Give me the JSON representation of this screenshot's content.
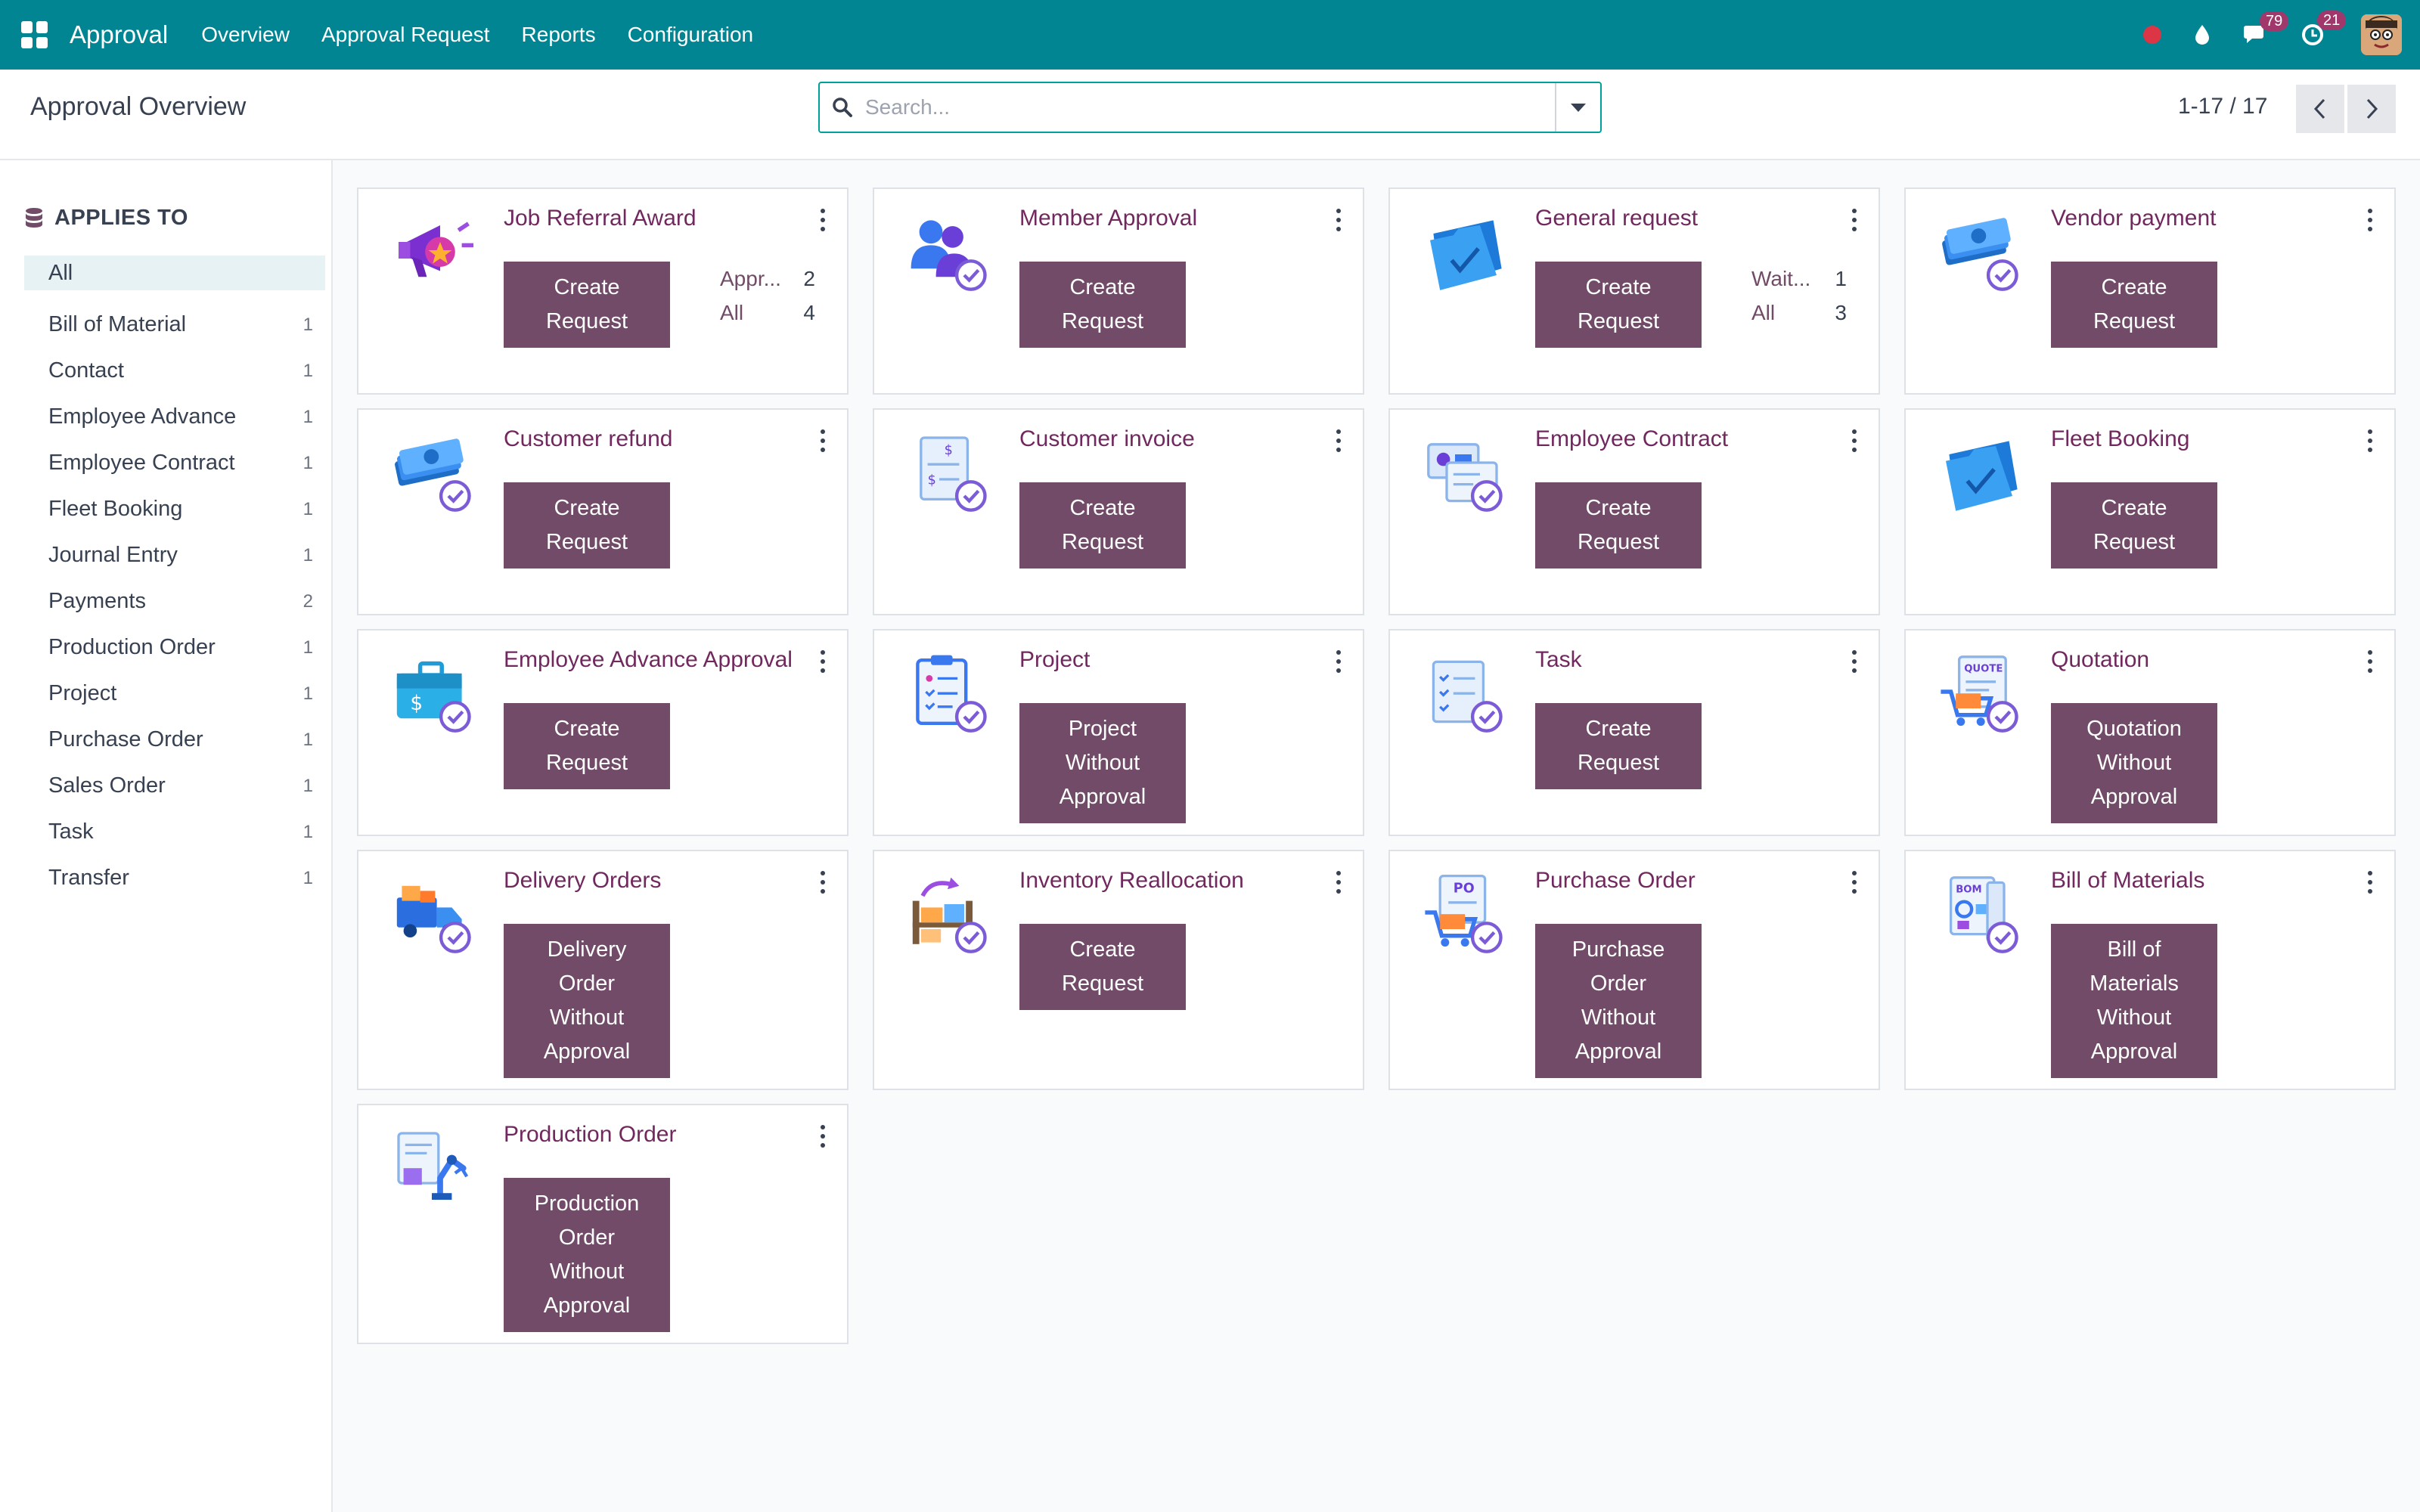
{
  "nav": {
    "app_name": "Approval",
    "menu": [
      "Overview",
      "Approval Request",
      "Reports",
      "Configuration"
    ],
    "messages_count": "79",
    "activities_count": "21"
  },
  "control_panel": {
    "title": "Approval Overview",
    "search_placeholder": "Search...",
    "pager": "1-17 / 17"
  },
  "sidebar": {
    "header": "APPLIES TO",
    "items": [
      {
        "label": "All",
        "count": ""
      },
      {
        "label": "Bill of Material",
        "count": "1"
      },
      {
        "label": "Contact",
        "count": "1"
      },
      {
        "label": "Employee Advance",
        "count": "1"
      },
      {
        "label": "Employee Contract",
        "count": "1"
      },
      {
        "label": "Fleet Booking",
        "count": "1"
      },
      {
        "label": "Journal Entry",
        "count": "1"
      },
      {
        "label": "Payments",
        "count": "2"
      },
      {
        "label": "Production Order",
        "count": "1"
      },
      {
        "label": "Project",
        "count": "1"
      },
      {
        "label": "Purchase Order",
        "count": "1"
      },
      {
        "label": "Sales Order",
        "count": "1"
      },
      {
        "label": "Task",
        "count": "1"
      },
      {
        "label": "Transfer",
        "count": "1"
      }
    ]
  },
  "cards": [
    {
      "title": "Job Referral Award",
      "icon": "megaphone-award-icon",
      "button": "Create\nRequest",
      "stats": [
        {
          "label": "Appr...",
          "value": "2"
        },
        {
          "label": "All",
          "value": "4"
        }
      ]
    },
    {
      "title": "Member Approval",
      "icon": "users-check-icon",
      "button": "Create\nRequest"
    },
    {
      "title": "General request",
      "icon": "folder-check-icon",
      "button": "Create\nRequest",
      "stats": [
        {
          "label": "Wait...",
          "value": "1"
        },
        {
          "label": "All",
          "value": "3"
        }
      ]
    },
    {
      "title": "Vendor payment",
      "icon": "money-check-icon",
      "button": "Create\nRequest"
    },
    {
      "title": "Customer refund",
      "icon": "money-check-icon",
      "button": "Create\nRequest"
    },
    {
      "title": "Customer invoice",
      "icon": "invoice-check-icon",
      "button": "Create\nRequest"
    },
    {
      "title": "Employee Contract",
      "icon": "contract-check-icon",
      "button": "Create\nRequest"
    },
    {
      "title": "Fleet Booking",
      "icon": "folder-check-icon",
      "button": "Create\nRequest"
    },
    {
      "title": "Employee Advance Approval",
      "icon": "briefcase-check-icon",
      "button": "Create\nRequest"
    },
    {
      "title": "Project",
      "icon": "clipboard-check-icon",
      "button": "Project\nWithout\nApproval"
    },
    {
      "title": "Task",
      "icon": "checklist-check-icon",
      "button": "Create\nRequest"
    },
    {
      "title": "Quotation",
      "icon": "quote-cart-check-icon",
      "button": "Quotation\nWithout\nApproval"
    },
    {
      "title": "Delivery Orders",
      "icon": "truck-check-icon",
      "button": "Delivery\nOrder\nWithout\nApproval"
    },
    {
      "title": "Inventory Reallocation",
      "icon": "boxes-check-icon",
      "button": "Create\nRequest"
    },
    {
      "title": "Purchase Order",
      "icon": "po-cart-check-icon",
      "button": "Purchase\nOrder\nWithout\nApproval"
    },
    {
      "title": "Bill of Materials",
      "icon": "bom-check-icon",
      "button": "Bill of\nMaterials\nWithout\nApproval"
    },
    {
      "title": "Production Order",
      "icon": "robot-arm-icon",
      "button": "Production\nOrder\nWithout\nApproval"
    }
  ],
  "colors": {
    "navbar": "#018592",
    "primary": "#714b67",
    "title": "#71285f"
  }
}
